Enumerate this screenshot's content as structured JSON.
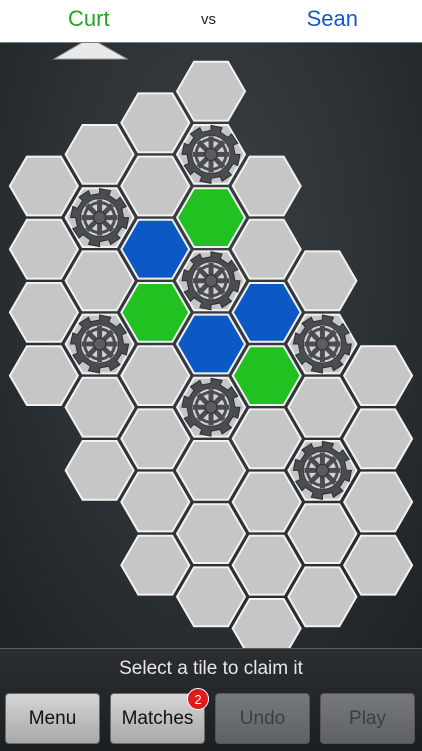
{
  "header": {
    "player1": "Curt",
    "vs": "vs",
    "player2": "Sean"
  },
  "colors": {
    "player1": "#1fa51f",
    "player2": "#1a57c4",
    "green_tile": "#22c122",
    "blue_tile": "#0c58c5",
    "empty_tile": "#c6c6c6"
  },
  "board": {
    "tiles": [
      {
        "q": 0,
        "r": -4,
        "state": "empty"
      },
      {
        "q": -1,
        "r": -3,
        "state": "empty"
      },
      {
        "q": 0,
        "r": -3,
        "state": "gear"
      },
      {
        "q": 1,
        "r": -3,
        "state": "empty"
      },
      {
        "q": -2,
        "r": -2,
        "state": "empty"
      },
      {
        "q": -1,
        "r": -2,
        "state": "empty"
      },
      {
        "q": 0,
        "r": -2,
        "state": "green"
      },
      {
        "q": 1,
        "r": -2,
        "state": "empty"
      },
      {
        "q": 2,
        "r": -2,
        "state": "empty"
      },
      {
        "q": -3,
        "r": -1,
        "state": "empty"
      },
      {
        "q": -2,
        "r": -1,
        "state": "gear"
      },
      {
        "q": -1,
        "r": -1,
        "state": "blue"
      },
      {
        "q": 0,
        "r": -1,
        "state": "gear"
      },
      {
        "q": 1,
        "r": -1,
        "state": "blue"
      },
      {
        "q": 2,
        "r": -1,
        "state": "gear"
      },
      {
        "q": 3,
        "r": -1,
        "state": "empty"
      },
      {
        "q": -3,
        "r": 0,
        "state": "empty"
      },
      {
        "q": -2,
        "r": 0,
        "state": "empty"
      },
      {
        "q": -1,
        "r": 0,
        "state": "green"
      },
      {
        "q": 0,
        "r": 0,
        "state": "blue"
      },
      {
        "q": 1,
        "r": 0,
        "state": "green"
      },
      {
        "q": 2,
        "r": 0,
        "state": "empty"
      },
      {
        "q": 3,
        "r": 0,
        "state": "empty"
      },
      {
        "q": -3,
        "r": 1,
        "state": "empty"
      },
      {
        "q": -2,
        "r": 1,
        "state": "gear"
      },
      {
        "q": -1,
        "r": 1,
        "state": "empty"
      },
      {
        "q": 0,
        "r": 1,
        "state": "gear"
      },
      {
        "q": 1,
        "r": 1,
        "state": "empty"
      },
      {
        "q": 2,
        "r": 1,
        "state": "gear"
      },
      {
        "q": 3,
        "r": 1,
        "state": "empty"
      },
      {
        "q": -3,
        "r": 2,
        "state": "empty"
      },
      {
        "q": -2,
        "r": 2,
        "state": "empty"
      },
      {
        "q": -1,
        "r": 2,
        "state": "empty"
      },
      {
        "q": 0,
        "r": 2,
        "state": "empty"
      },
      {
        "q": 1,
        "r": 2,
        "state": "empty"
      },
      {
        "q": 2,
        "r": 2,
        "state": "empty"
      },
      {
        "q": 3,
        "r": 2,
        "state": "empty"
      },
      {
        "q": -2,
        "r": 3,
        "state": "empty"
      },
      {
        "q": -1,
        "r": 3,
        "state": "empty"
      },
      {
        "q": 0,
        "r": 3,
        "state": "empty"
      },
      {
        "q": 1,
        "r": 3,
        "state": "empty"
      },
      {
        "q": 2,
        "r": 3,
        "state": "empty"
      },
      {
        "q": -1,
        "r": 4,
        "state": "empty"
      },
      {
        "q": 1,
        "r": 4,
        "state": "empty"
      },
      {
        "q": 0,
        "r": 4,
        "state": "empty"
      }
    ]
  },
  "footer": {
    "status": "Select a tile to claim it",
    "buttons": {
      "menu": "Menu",
      "matches": "Matches",
      "matches_badge": "2",
      "undo": "Undo",
      "play": "Play"
    }
  }
}
